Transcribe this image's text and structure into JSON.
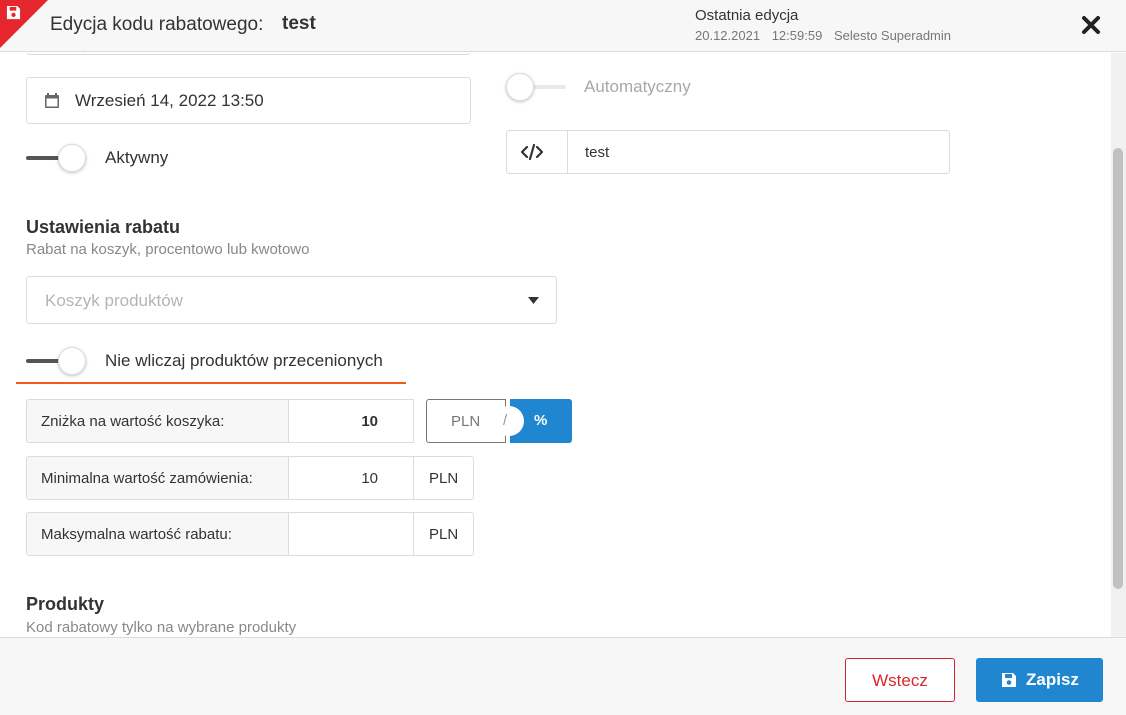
{
  "header": {
    "title_label": "Edycja kodu rabatowego:",
    "title_value": "test",
    "last_edit_label": "Ostatnia edycja",
    "last_edit_date": "20.12.2021",
    "last_edit_time": "12:59:59",
    "last_edit_user": "Selesto Superadmin",
    "corner_icon": "save-icon",
    "close_icon": "close-icon"
  },
  "form": {
    "date_value": "Wrzesień 14, 2022 13:50",
    "date_icon": "calendar-icon",
    "automatic_label": "Automatyczny",
    "automatic_on": false,
    "active_label": "Aktywny",
    "active_on": true,
    "code_icon": "code-icon",
    "code_value": "test"
  },
  "discount_settings": {
    "title": "Ustawienia rabatu",
    "subtitle": "Rabat na koszyk, procentowo lub kwotowo",
    "select_placeholder": "Koszyk produktów",
    "exclude_label": "Nie wliczaj produktów przecenionych",
    "exclude_on": true,
    "rows": [
      {
        "label": "Zniżka na wartość koszyka:",
        "value": "10"
      },
      {
        "label": "Minimalna wartość zamówienia:",
        "value": "10",
        "unit": "PLN"
      },
      {
        "label": "Maksymalna wartość rabatu:",
        "value": "",
        "unit": "PLN"
      }
    ],
    "unit_toggle": {
      "option_a": "PLN",
      "separator": "/",
      "option_b": "%",
      "selected": "%"
    }
  },
  "products": {
    "title": "Produkty",
    "subtitle": "Kod rabatowy tylko na wybrane produkty"
  },
  "footer": {
    "back_label": "Wstecz",
    "save_label": "Zapisz",
    "save_icon": "save-icon"
  },
  "colors": {
    "accent": "#1f86cf",
    "danger": "#e5272d",
    "highlight": "#f05a1e"
  }
}
